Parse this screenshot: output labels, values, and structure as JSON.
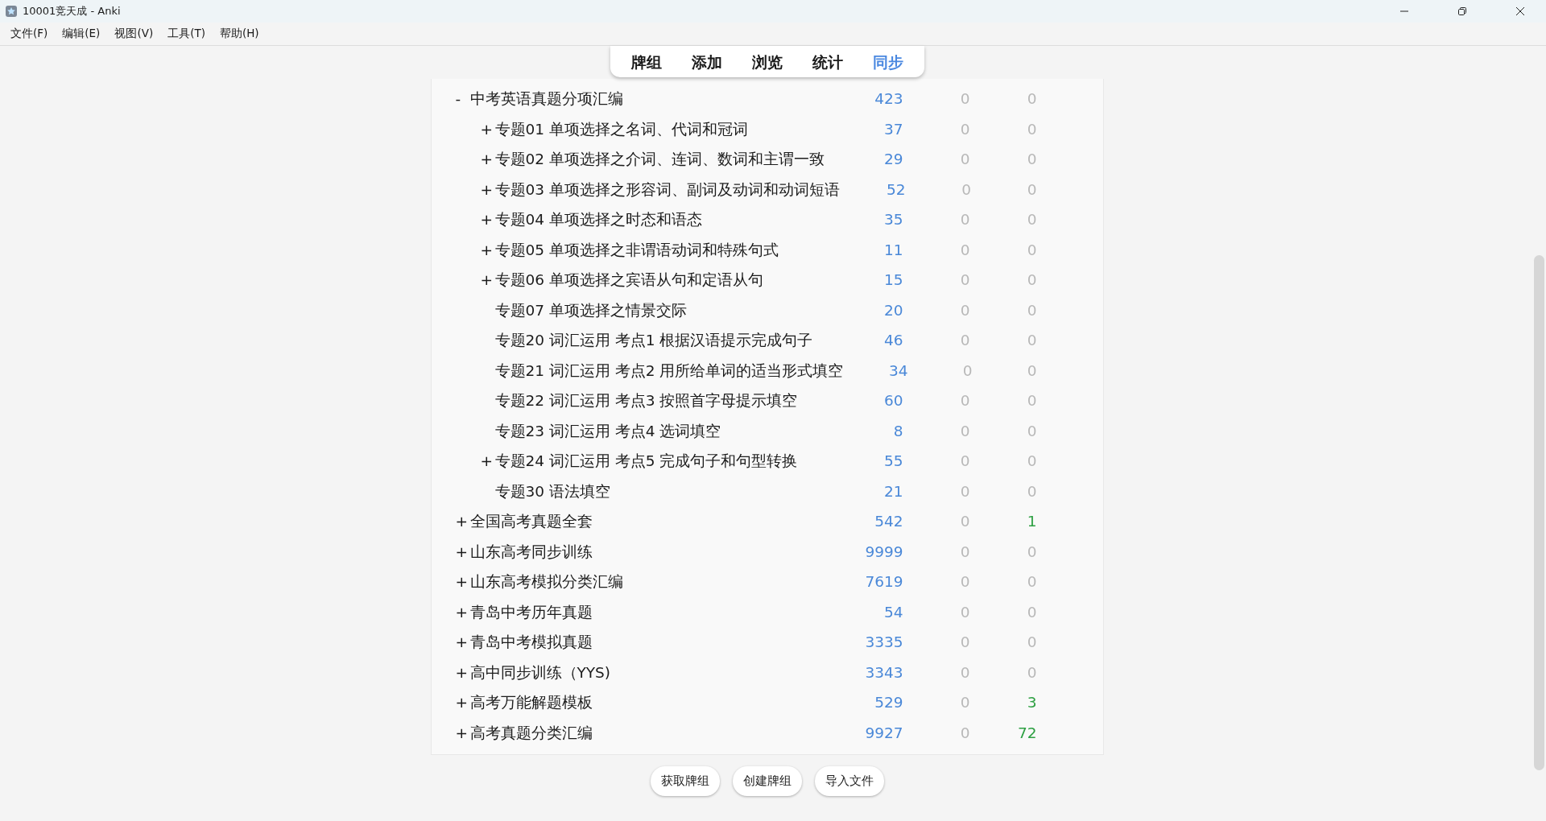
{
  "window": {
    "title": "10001竞天成 - Anki"
  },
  "menu": [
    "文件(F)",
    "编辑(E)",
    "视图(V)",
    "工具(T)",
    "帮助(H)"
  ],
  "tabs": [
    {
      "label": "牌组",
      "selected": false
    },
    {
      "label": "添加",
      "selected": false
    },
    {
      "label": "浏览",
      "selected": false
    },
    {
      "label": "统计",
      "selected": false
    },
    {
      "label": "同步",
      "selected": true
    }
  ],
  "decks": [
    {
      "toggle": "-",
      "name": "中考英语真题分项汇编",
      "counts": [
        {
          "value": "423",
          "dim": false
        },
        {
          "value": "0",
          "dim": true
        },
        {
          "value": "0",
          "dim": true
        }
      ],
      "children": [
        {
          "toggle": "+",
          "name": "专题01 单项选择之名词、代词和冠词",
          "counts": [
            {
              "value": "37",
              "dim": false
            },
            {
              "value": "0",
              "dim": true
            },
            {
              "value": "0",
              "dim": true
            }
          ]
        },
        {
          "toggle": "+",
          "name": "专题02 单项选择之介词、连词、数词和主谓一致",
          "counts": [
            {
              "value": "29",
              "dim": false
            },
            {
              "value": "0",
              "dim": true
            },
            {
              "value": "0",
              "dim": true
            }
          ]
        },
        {
          "toggle": "+",
          "name": "专题03 单项选择之形容词、副词及动词和动词短语",
          "counts": [
            {
              "value": "52",
              "dim": false
            },
            {
              "value": "0",
              "dim": true
            },
            {
              "value": "0",
              "dim": true
            }
          ]
        },
        {
          "toggle": "+",
          "name": "专题04 单项选择之时态和语态",
          "counts": [
            {
              "value": "35",
              "dim": false
            },
            {
              "value": "0",
              "dim": true
            },
            {
              "value": "0",
              "dim": true
            }
          ]
        },
        {
          "toggle": "+",
          "name": "专题05 单项选择之非谓语动词和特殊句式",
          "counts": [
            {
              "value": "11",
              "dim": false
            },
            {
              "value": "0",
              "dim": true
            },
            {
              "value": "0",
              "dim": true
            }
          ]
        },
        {
          "toggle": "+",
          "name": "专题06 单项选择之宾语从句和定语从句",
          "counts": [
            {
              "value": "15",
              "dim": false
            },
            {
              "value": "0",
              "dim": true
            },
            {
              "value": "0",
              "dim": true
            }
          ]
        },
        {
          "name": "专题07 单项选择之情景交际",
          "counts": [
            {
              "value": "20",
              "dim": false
            },
            {
              "value": "0",
              "dim": true
            },
            {
              "value": "0",
              "dim": true
            }
          ]
        },
        {
          "name": "专题20 词汇运用 考点1 根据汉语提示完成句子",
          "counts": [
            {
              "value": "46",
              "dim": false
            },
            {
              "value": "0",
              "dim": true
            },
            {
              "value": "0",
              "dim": true
            }
          ]
        },
        {
          "name": "专题21 词汇运用 考点2 用所给单词的适当形式填空",
          "counts": [
            {
              "value": "34",
              "dim": false
            },
            {
              "value": "0",
              "dim": true
            },
            {
              "value": "0",
              "dim": true
            }
          ]
        },
        {
          "name": "专题22 词汇运用 考点3 按照首字母提示填空",
          "counts": [
            {
              "value": "60",
              "dim": false
            },
            {
              "value": "0",
              "dim": true
            },
            {
              "value": "0",
              "dim": true
            }
          ]
        },
        {
          "name": "专题23 词汇运用 考点4 选词填空",
          "counts": [
            {
              "value": "8",
              "dim": false
            },
            {
              "value": "0",
              "dim": true
            },
            {
              "value": "0",
              "dim": true
            }
          ]
        },
        {
          "toggle": "+",
          "name": "专题24 词汇运用 考点5 完成句子和句型转换",
          "counts": [
            {
              "value": "55",
              "dim": false
            },
            {
              "value": "0",
              "dim": true
            },
            {
              "value": "0",
              "dim": true
            }
          ]
        },
        {
          "name": "专题30 语法填空",
          "counts": [
            {
              "value": "21",
              "dim": false
            },
            {
              "value": "0",
              "dim": true
            },
            {
              "value": "0",
              "dim": true
            }
          ]
        }
      ]
    },
    {
      "toggle": "+",
      "name": "全国高考真题全套",
      "counts": [
        {
          "value": "542",
          "dim": false
        },
        {
          "value": "0",
          "dim": true
        },
        {
          "value": "1",
          "dim": false
        }
      ]
    },
    {
      "toggle": "+",
      "name": "山东高考同步训练",
      "counts": [
        {
          "value": "9999",
          "dim": false
        },
        {
          "value": "0",
          "dim": true
        },
        {
          "value": "0",
          "dim": true
        }
      ]
    },
    {
      "toggle": "+",
      "name": "山东高考模拟分类汇编",
      "counts": [
        {
          "value": "7619",
          "dim": false
        },
        {
          "value": "0",
          "dim": true
        },
        {
          "value": "0",
          "dim": true
        }
      ]
    },
    {
      "toggle": "+",
      "name": "青岛中考历年真题",
      "counts": [
        {
          "value": "54",
          "dim": false
        },
        {
          "value": "0",
          "dim": true
        },
        {
          "value": "0",
          "dim": true
        }
      ]
    },
    {
      "toggle": "+",
      "name": "青岛中考模拟真题",
      "counts": [
        {
          "value": "3335",
          "dim": false
        },
        {
          "value": "0",
          "dim": true
        },
        {
          "value": "0",
          "dim": true
        }
      ]
    },
    {
      "toggle": "+",
      "name": "高中同步训练（YYS)",
      "counts": [
        {
          "value": "3343",
          "dim": false
        },
        {
          "value": "0",
          "dim": true
        },
        {
          "value": "0",
          "dim": true
        }
      ]
    },
    {
      "toggle": "+",
      "name": "高考万能解题模板",
      "counts": [
        {
          "value": "529",
          "dim": false
        },
        {
          "value": "0",
          "dim": true
        },
        {
          "value": "3",
          "dim": false
        }
      ]
    },
    {
      "toggle": "+",
      "name": "高考真题分类汇编",
      "counts": [
        {
          "value": "9927",
          "dim": false
        },
        {
          "value": "0",
          "dim": true
        },
        {
          "value": "72",
          "dim": false
        }
      ]
    }
  ],
  "buttons": [
    "获取牌组",
    "创建牌组",
    "导入文件"
  ]
}
